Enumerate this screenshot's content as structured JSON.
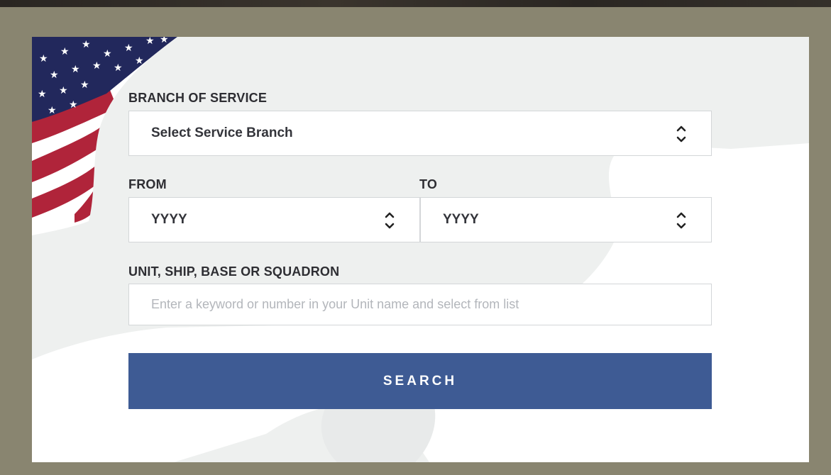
{
  "form": {
    "branch": {
      "label": "BRANCH OF SERVICE",
      "value": "Select Service Branch"
    },
    "from": {
      "label": "FROM",
      "value": "YYYY"
    },
    "to": {
      "label": "TO",
      "value": "YYYY"
    },
    "unit": {
      "label": "UNIT, SHIP, BASE OR SQUADRON",
      "value": "",
      "placeholder": "Enter a keyword or number in your Unit name and select from list"
    },
    "search_label": "SEARCH"
  },
  "colors": {
    "frame": "#898570",
    "card": "#eef0ef",
    "button": "#3e5b94",
    "label_text": "#2e2e33",
    "flag_red": "#b0243a",
    "flag_blue": "#22285c"
  },
  "icons": {
    "flag": "us-flag-icon",
    "select_arrows": "chevron-up-down-icon"
  }
}
